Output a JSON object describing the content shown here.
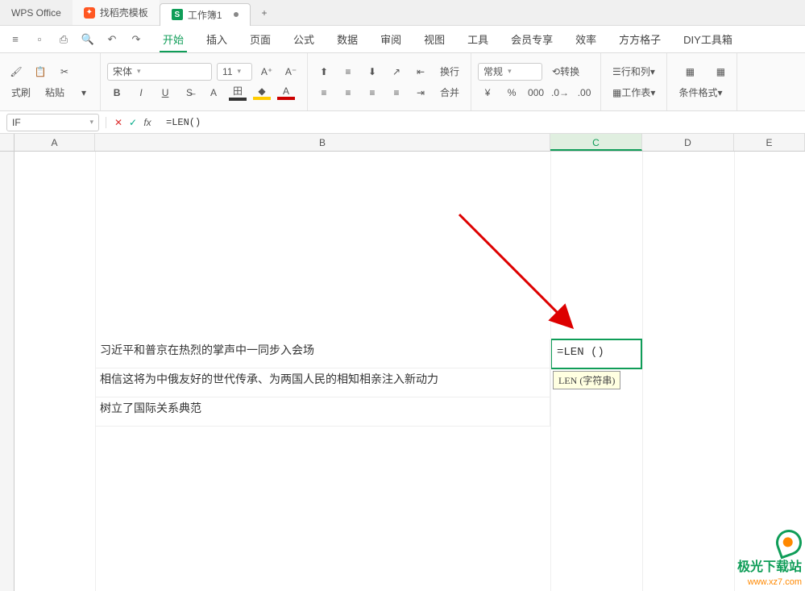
{
  "tabs": {
    "app_label": "WPS Office",
    "template_label": "找稻壳模板",
    "doc_icon": "S",
    "doc_label": "工作簿1",
    "plus": "+"
  },
  "menu": {
    "items": [
      "开始",
      "插入",
      "页面",
      "公式",
      "数据",
      "审阅",
      "视图",
      "工具",
      "会员专享",
      "效率",
      "方方格子",
      "DIY工具箱"
    ]
  },
  "ribbon": {
    "fmt_label": "式刷",
    "paste_label": "粘贴",
    "font_name": "宋体",
    "font_size": "11",
    "num_style": "常规",
    "convert": "转换",
    "row_col": "行和列",
    "wrap": "换行",
    "merge": "合并",
    "worksheet": "工作表",
    "cond_fmt": "条件格式"
  },
  "fx": {
    "name": "IF",
    "formula": "=LEN()"
  },
  "cols": [
    "A",
    "B",
    "C",
    "D",
    "E"
  ],
  "cells": {
    "b1": "习近平和普京在热烈的掌声中一同步入会场",
    "c1_formula": "=LEN ()",
    "b2": "相信这将为中俄友好的世代传承、为两国人民的相知相亲注入新动力",
    "tooltip": "LEN (字符串)",
    "b3": "树立了国际关系典范"
  },
  "watermark": {
    "name": "极光下载站",
    "url": "www.xz7.com"
  }
}
